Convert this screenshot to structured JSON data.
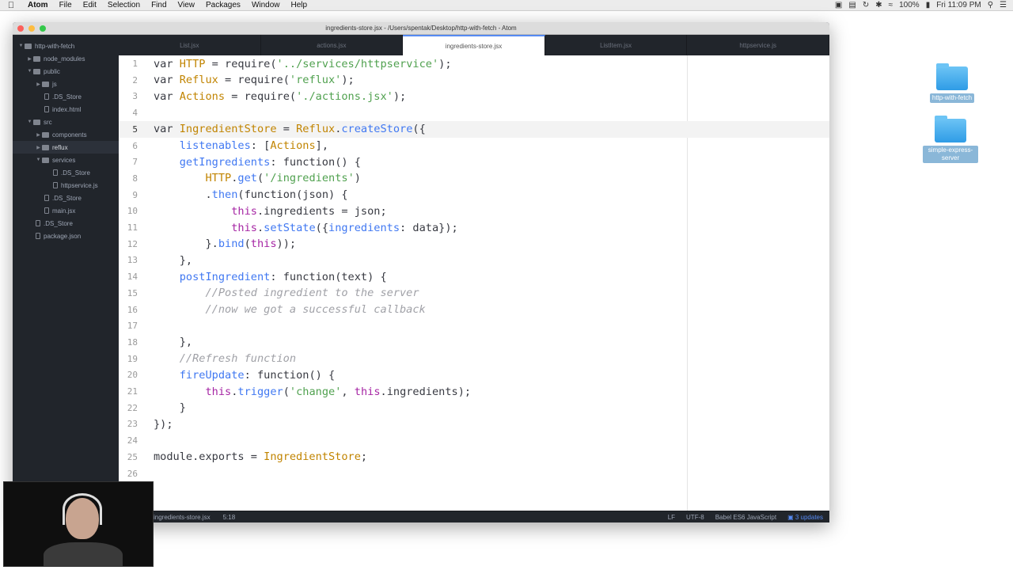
{
  "menubar": {
    "app": "Atom",
    "items": [
      "File",
      "Edit",
      "Selection",
      "Find",
      "View",
      "Packages",
      "Window",
      "Help"
    ],
    "battery": "100%",
    "clock": "Fri 11:09 PM"
  },
  "window": {
    "title": "ingredients-store.jsx - /Users/spentak/Desktop/http-with-fetch - Atom"
  },
  "tree": [
    {
      "label": "http-with-fetch",
      "depth": 0,
      "type": "dir",
      "open": true
    },
    {
      "label": "node_modules",
      "depth": 1,
      "type": "dir",
      "open": false
    },
    {
      "label": "public",
      "depth": 1,
      "type": "dir",
      "open": true
    },
    {
      "label": "js",
      "depth": 2,
      "type": "dir",
      "open": false
    },
    {
      "label": ".DS_Store",
      "depth": 2,
      "type": "file"
    },
    {
      "label": "index.html",
      "depth": 2,
      "type": "file"
    },
    {
      "label": "src",
      "depth": 1,
      "type": "dir",
      "open": true
    },
    {
      "label": "components",
      "depth": 2,
      "type": "dir",
      "open": false
    },
    {
      "label": "reflux",
      "depth": 2,
      "type": "dir",
      "open": false,
      "selected": true
    },
    {
      "label": "services",
      "depth": 2,
      "type": "dir",
      "open": true
    },
    {
      "label": ".DS_Store",
      "depth": 3,
      "type": "file"
    },
    {
      "label": "httpservice.js",
      "depth": 3,
      "type": "file"
    },
    {
      "label": ".DS_Store",
      "depth": 2,
      "type": "file"
    },
    {
      "label": "main.jsx",
      "depth": 2,
      "type": "file"
    },
    {
      "label": ".DS_Store",
      "depth": 1,
      "type": "file"
    },
    {
      "label": "package.json",
      "depth": 1,
      "type": "file"
    }
  ],
  "tabs": [
    {
      "label": "List.jsx",
      "active": false
    },
    {
      "label": "actions.jsx",
      "active": false
    },
    {
      "label": "ingredients-store.jsx",
      "active": true
    },
    {
      "label": "ListItem.jsx",
      "active": false
    },
    {
      "label": "httpservice.js",
      "active": false
    }
  ],
  "code_lines": [
    "var HTTP = require('../services/httpservice');",
    "var Reflux = require('reflux');",
    "var Actions = require('./actions.jsx');",
    "",
    "var IngredientStore = Reflux.createStore({",
    "    listenables: [Actions],",
    "    getIngredients: function() {",
    "        HTTP.get('/ingredients')",
    "        .then(function(json) {",
    "            this.ingredients = json;",
    "            this.setState({ingredients: data});",
    "        }.bind(this));",
    "    },",
    "    postIngredient: function(text) {",
    "        //Posted ingredient to the server",
    "        //now we got a successful callback",
    "",
    "    },",
    "    //Refresh function",
    "    fireUpdate: function() {",
    "        this.trigger('change', this.ingredients);",
    "    }",
    "});",
    "",
    "module.exports = IngredientStore;",
    ""
  ],
  "cursor_line": 5,
  "status": {
    "file": "ingredients-store.jsx",
    "position": "5:18",
    "line_ending": "LF",
    "encoding": "UTF-8",
    "grammar": "Babel ES6 JavaScript",
    "updates": "3 updates"
  },
  "desktop": [
    {
      "label": "http-with-fetch"
    },
    {
      "label": "simple-express-server"
    }
  ]
}
